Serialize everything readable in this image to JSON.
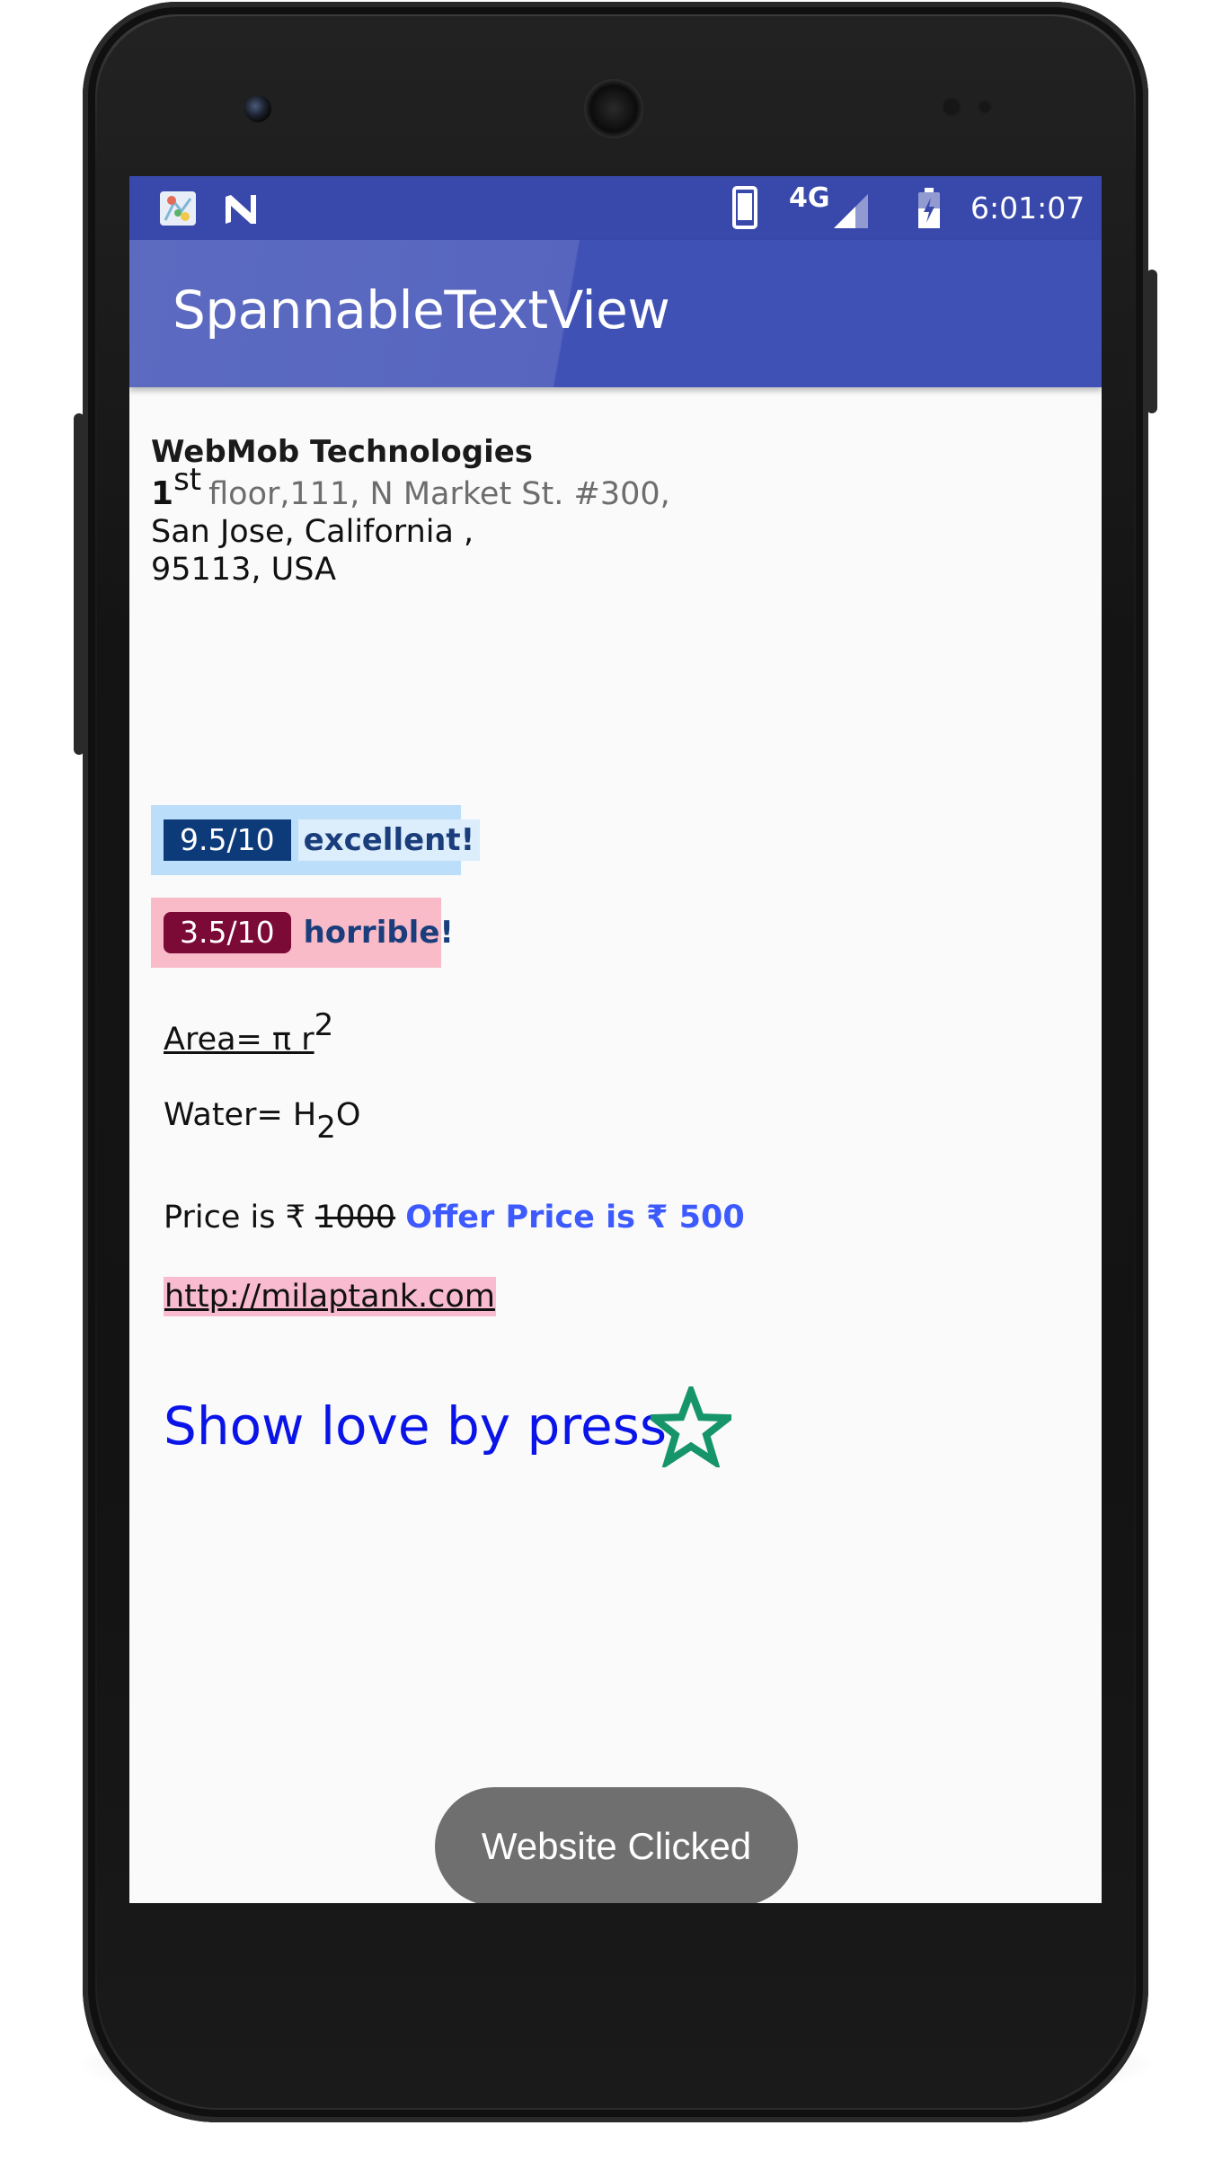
{
  "status_bar": {
    "network": "4G",
    "time": "6:01:07",
    "icons": [
      "maps-notification-icon",
      "n-notification-icon",
      "phone-icon",
      "signal-icon",
      "battery-icon"
    ]
  },
  "app_bar": {
    "title": "SpannableTextView"
  },
  "address": {
    "company": "WebMob Technologies",
    "floor_number": "1",
    "floor_suffix": "st",
    "line1_rest": "floor,111, N Market St. #300,",
    "line2": "San Jose, California ,",
    "line3": "95113, USA"
  },
  "ratings": [
    {
      "score": "9.5/10",
      "label": "excellent!",
      "box_color": "#bbdefb",
      "score_color": "#0d3b7a"
    },
    {
      "score": "3.5/10",
      "label": "horrible!",
      "box_color": "#f8bbc7",
      "score_color": "#7b0a36"
    }
  ],
  "formulas": {
    "area_prefix": "Area= π r",
    "area_exponent": "2",
    "water_prefix": "Water= H",
    "water_subscript": "2",
    "water_suffix": "O"
  },
  "price": {
    "prefix": "Price is ₹ ",
    "old_price": "1000",
    "offer": "Offer Price is ₹ 500"
  },
  "link": {
    "text": "http://milaptank.com"
  },
  "love": {
    "text": "Show love by press",
    "star_icon": "star-outline-icon",
    "star_color": "#16946a"
  },
  "toast": {
    "text": "Website Clicked"
  },
  "colors": {
    "status_bar": "#3949ab",
    "app_bar": "#3f51b5",
    "offer_text": "#3d5afe",
    "love_text": "#0a14e8",
    "link_highlight": "#f8bbd0"
  }
}
